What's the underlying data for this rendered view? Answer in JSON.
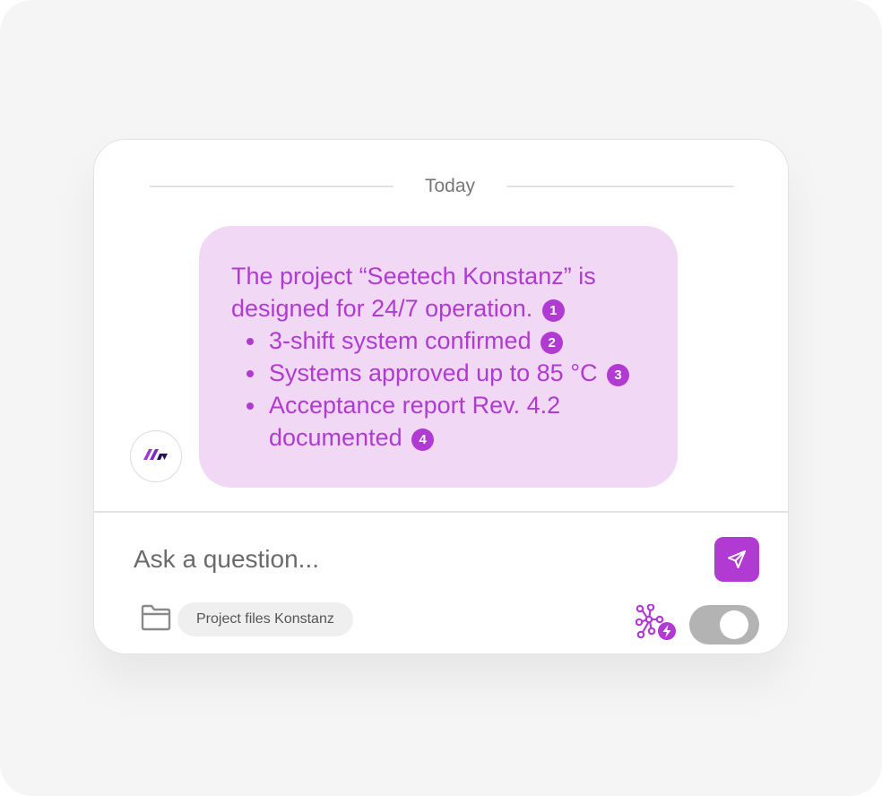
{
  "chat": {
    "date_label": "Today",
    "message": {
      "intro": "The project “Seetech Konstanz” is designed for 24/7 operation.",
      "intro_cite": "1",
      "bullets": [
        {
          "text": "3-shift system confirmed",
          "cite": "2"
        },
        {
          "text": "Systems approved up to 85 °C",
          "cite": "3"
        },
        {
          "text": "Acceptance report Rev. 4.2 documented",
          "cite": "4"
        }
      ]
    },
    "assistant_avatar_icon": "brand-logo-icon"
  },
  "composer": {
    "placeholder": "Ask a question...",
    "send_icon": "send-icon",
    "folder_icon": "folder-icon",
    "source_chip": "Project files Konstanz",
    "knowledge_graph_icon": "knowledge-graph-icon",
    "toggle_on": false
  },
  "colors": {
    "accent": "#b13ad3",
    "bubble_background": "#f1d9f5",
    "page_background": "#f5f5f5",
    "card_background": "#ffffff",
    "toggle_off": "#b3b3b3"
  }
}
